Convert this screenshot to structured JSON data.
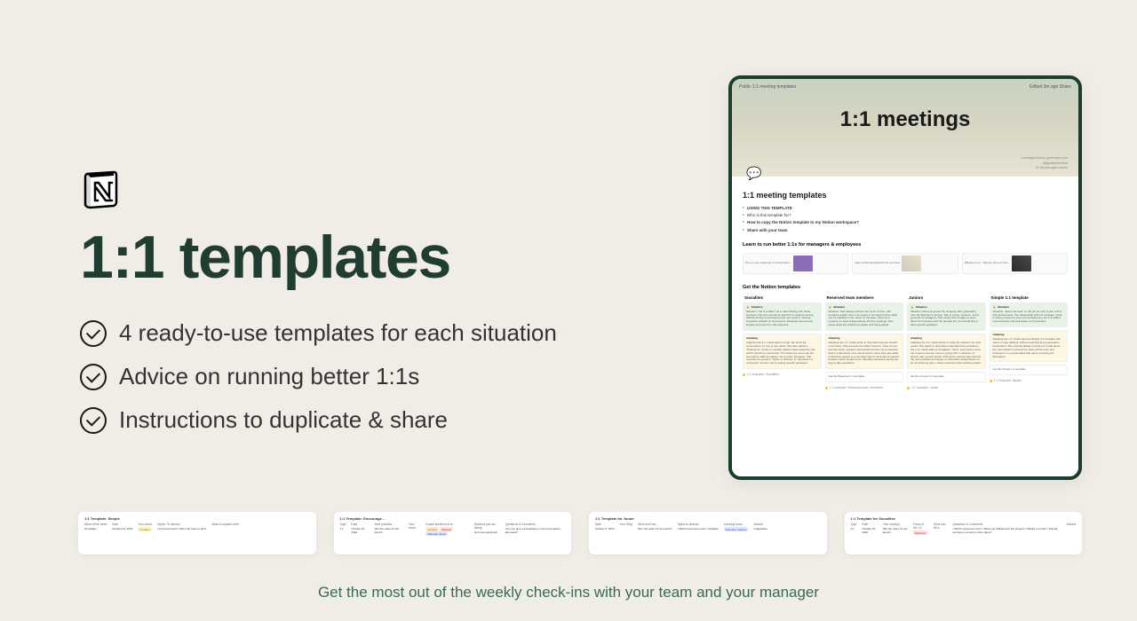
{
  "main": {
    "title": "1:1 templates",
    "features": [
      "4 ready-to-use templates for each situation",
      "Advice on running better 1:1s",
      "Instructions to duplicate & share"
    ]
  },
  "preview": {
    "topbar_left": "Public   1:1 meeting templates",
    "topbar_right": "Edited 3m ago  Share",
    "title": "1:1 meetings",
    "byline_1": "managerhacks.gumroad.com",
    "byline_2": "@lightnessmind",
    "byline_3": "IG @manager.hacks",
    "section_title": "1:1 meeting templates",
    "bullets_header": "USING THIS TEMPLATE",
    "bullets": [
      "Who is this template for?",
      "How to copy the Notion template to my Notion workspace?",
      "Share with your team"
    ],
    "learn_title": "Learn to run better 1:1s for managers & employees",
    "learn_cards": [
      "One-on-one meetings: A comprehens...",
      "How to Run Exceptional One-on-Ones",
      "Effective 1:1s - Tips For One-on-One..."
    ],
    "get_title": "Get the Notion templates",
    "columns": [
      {
        "header": "Socialites",
        "situation": "Situation: Yas is a talker. He is often flowing with ideas. However, this can sometimes lead him to defocus and go offtrack during conversations and can result in missing important updates on his projects. Meetings can become lengthy and miss the main objective.",
        "adapting": "Adapting the 1:1: Carla wants to help Yas focus the conversation on one or two topics. She also added a \"Parking lot\" section to quickly capture ideas raised by Yas which should be sorted later. This helps her sit-ua-ate the interruption without making Yas repress Yas ideas. She renames the generic \"Topics to discuss\" to \"Questions & comments\" to steer Yas to asking specific questions.",
        "footer": "1:1 example: Socialites"
      },
      {
        "header": "Reserved team members",
        "situation": "Situation: Sani always delivers her work on time, with excellent quality. She is an expert in her field and her skills can be valuable to the others in the team. She has a tendency to work independently. During meetings, Sani rarely takes the initiative to speak until being asked.",
        "adapting": "Adapting the 1:1: Carla wants to help Sani express herself more freely. She removes the rather freeform \"How do you feel this week\" question and transforms this into a selection field to understand more about Sani's mood. She also adds a Shoutout section to encourage Sani to think about specific blockers which would not be naturally expressed during the day-to-day operations.",
        "link": "Get the Reserved 1:1 template",
        "footer": "1:1 example: Reserved team members"
      },
      {
        "header": "Juniors",
        "situation": "Situation: Alice just joined the company after graduating from her Bachelor's degree. She is young, dynamic, and a great fan of Instagram. She shows she is eager to learn about the business and her specific job, and would like to have specific guidance.",
        "adapting": "Adapting the 1:1: Carla wants to make the check-in fun and useful. She wants to help Alice understand the priorities in the 1:1s. Carla adds an Instagram \"Story\" area where Anna can express how her week is going with a collection of photos, like a quick sketch. During the meeting they discuss the next priorities and agree on what Alice should focus on for her learning plan + share resources that could be useful.",
        "link": "Get the Juniors 1:1 template",
        "footer": "1:1 example: Junior"
      },
      {
        "header": "Simple 1:1 template",
        "situation": "Situation: Jason has been on the job for over a year and is fully autonomous. The relationship with his manager, Carla, is strong, based on trust and transparency. He is a skilled communicator and well aware of his priorities.",
        "adapting": "Adapting the 1:1: Carla uses the Simple 1:1 template with Jason to stay efficient, without requiring long preparation beforehand. She recently added a check-ins to talk about key topic which is relevant for Jason all the time and brainstorm on several ideas that came up during the discussion.",
        "link": "Get the Simple 1:1 template",
        "footer": "1:1 Example: simple"
      }
    ]
  },
  "thumbnails": [
    {
      "title": "1:1 Template: Simple",
      "cols": [
        "Mood of the week",
        "Date",
        "Your mood",
        "Topics: To discuss",
        "Ideas to expand on/re"
      ],
      "row": [
        "Templates",
        "October 13, 2022",
        "It's alive!",
        "• Announcement!\n• Who can help on dev?",
        ""
      ]
    },
    {
      "title": "1:1 Template: Encourage...",
      "cols": [
        "Type",
        "Date",
        "Next priorities",
        "Your mood",
        "Impact achieved at w...",
        "Blockers you are facing",
        "Questions & Comments"
      ],
      "row": [
        "1:1",
        "October 27, 2022",
        "Win the video for the launch",
        "Content  Strategy  Manager hacks",
        "Got new equipment",
        "Can you give me feedback on the presentation last week?"
      ]
    },
    {
      "title": "1:1 Template for Junior",
      "cols": [
        "Date",
        "Your Story",
        "Wins and Nos...",
        "Topics to discuss",
        "Learning focus",
        "Actions"
      ],
      "row": [
        "October 6, 2022",
        "",
        "Win: the video for the launch",
        "• Which resources now?\n• Holidays",
        "Premiere mastery",
        "Imagination"
      ]
    },
    {
      "title": "1:1 Template for Socialites",
      "cols": [
        "Type",
        "Date",
        "Your mood(s)",
        "Focus of the 1:1",
        "Wins and No's",
        "Questions & Comments",
        "Actions"
      ],
      "row": [
        "1:1",
        "October 20, 2022",
        "Win the video for the launch",
        "Discount",
        "• Which resources now?\n• When can Marisol join the project?\n• What's on prod?\n• Should we have 2 versions of the video?",
        ""
      ]
    }
  ],
  "footer": "Get the most out of the weekly check-ins with your team and your manager"
}
